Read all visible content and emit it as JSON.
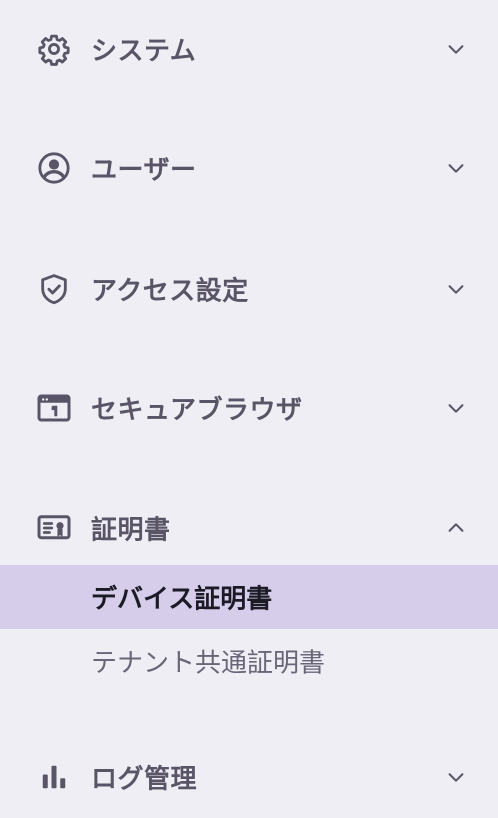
{
  "nav": {
    "sections": [
      {
        "label": "システム",
        "icon": "gear-icon",
        "expanded": false
      },
      {
        "label": "ユーザー",
        "icon": "user-circle-icon",
        "expanded": false
      },
      {
        "label": "アクセス設定",
        "icon": "shield-check-icon",
        "expanded": false
      },
      {
        "label": "セキュアブラウザ",
        "icon": "browser-window-icon",
        "expanded": false
      },
      {
        "label": "証明書",
        "icon": "certificate-icon",
        "expanded": true,
        "items": [
          {
            "label": "デバイス証明書",
            "active": true
          },
          {
            "label": "テナント共通証明書",
            "active": false
          }
        ]
      },
      {
        "label": "ログ管理",
        "icon": "bar-chart-icon",
        "expanded": false
      }
    ]
  },
  "colors": {
    "background": "#efeef5",
    "text": "#595566",
    "active_background": "#d5cdea",
    "active_text": "#1c1a26"
  }
}
